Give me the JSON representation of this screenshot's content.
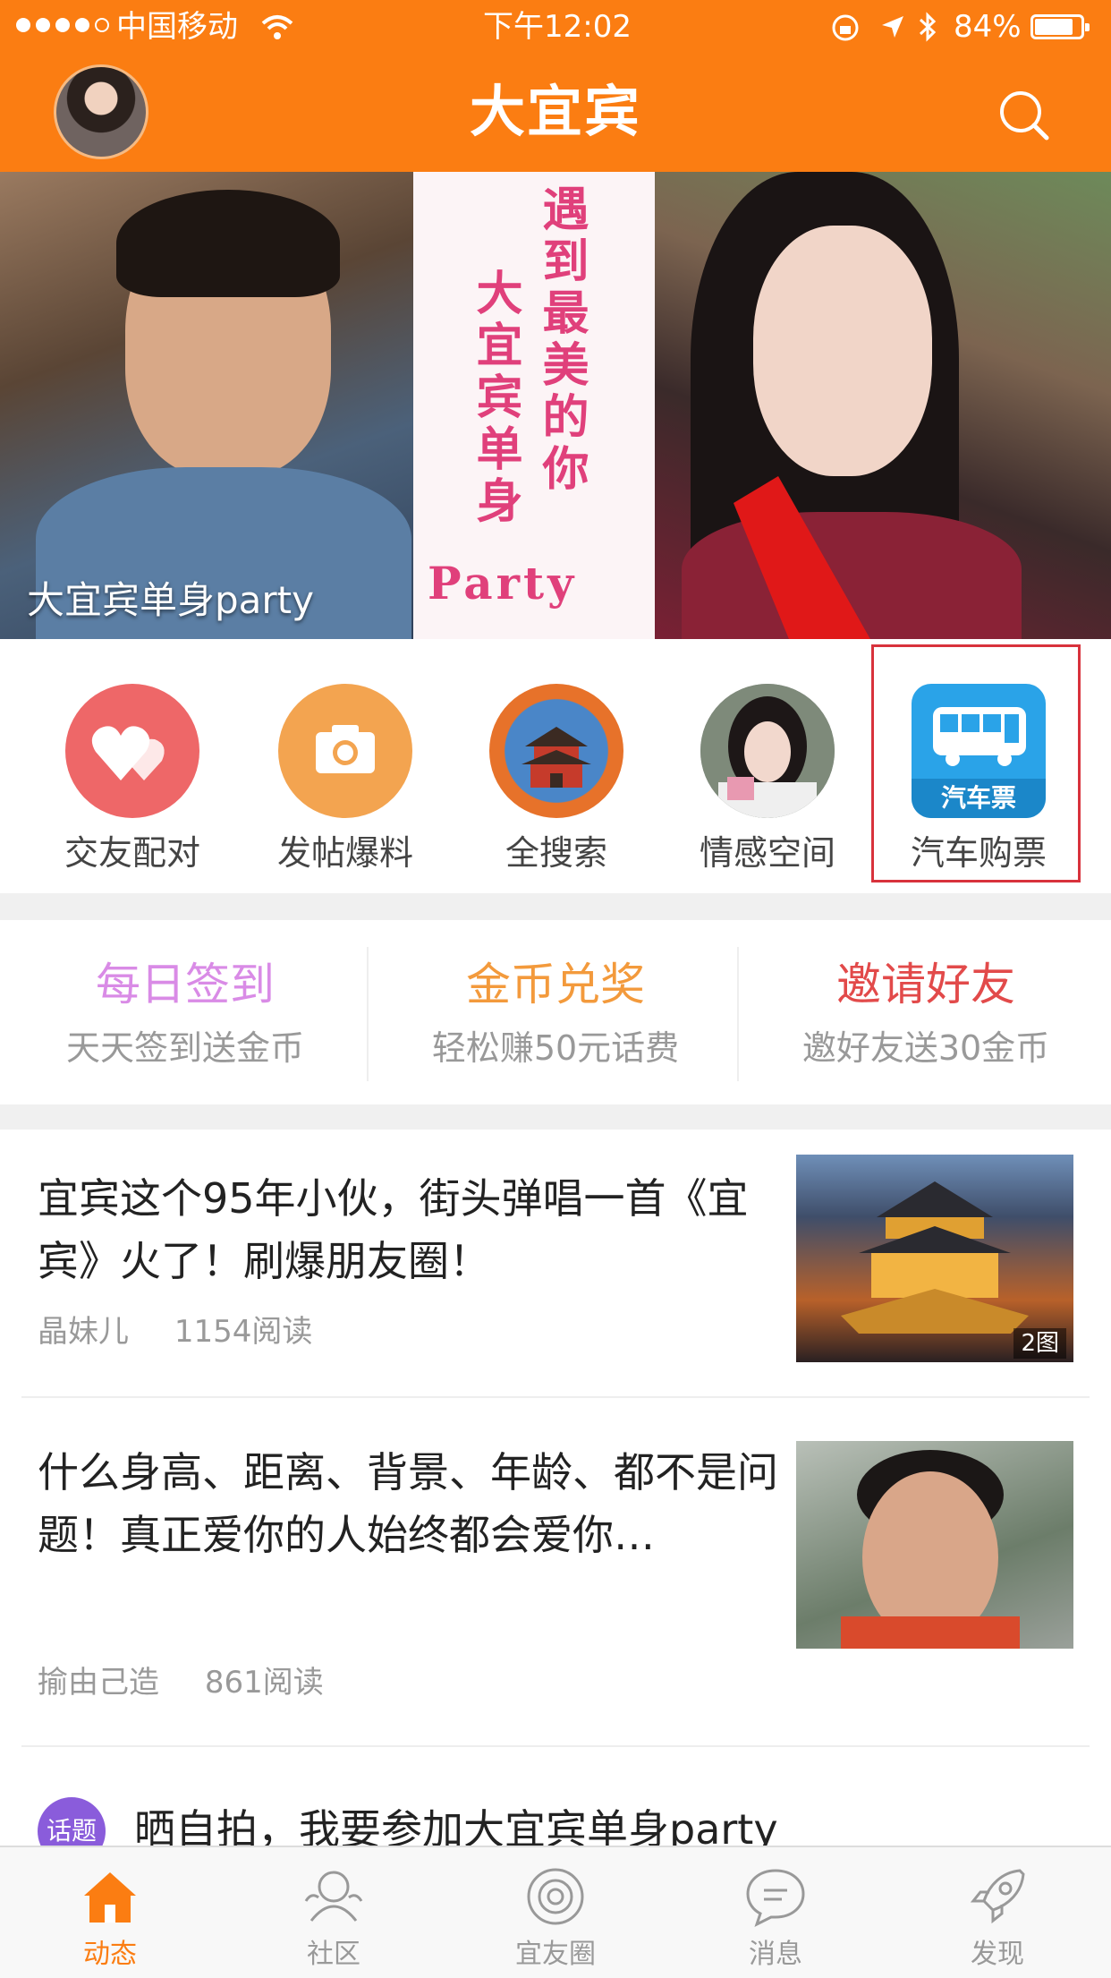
{
  "status_bar": {
    "carrier": "中国移动",
    "time": "下午12:02",
    "battery": "84%",
    "battery_level": 0.84
  },
  "header": {
    "title": "大宜宾"
  },
  "banner": {
    "caption": "大宜宾单身party",
    "line1": "遇到最美的你",
    "line2": "大宜宾单身",
    "line3": "Party"
  },
  "quick_actions": [
    {
      "label": "交友配对",
      "icon": "heart-icon"
    },
    {
      "label": "发帖爆料",
      "icon": "camera-icon"
    },
    {
      "label": "全搜索",
      "icon": "tower-icon"
    },
    {
      "label": "情感空间",
      "icon": "portrait-icon"
    },
    {
      "label": "汽车购票",
      "icon": "bus-icon",
      "badge": "汽车票"
    }
  ],
  "promos": [
    {
      "title": "每日签到",
      "subtitle": "天天签到送金币",
      "color": "#d98be6"
    },
    {
      "title": "金币兑奖",
      "subtitle": "轻松赚50元话费",
      "color": "#f39a3c"
    },
    {
      "title": "邀请好友",
      "subtitle": "邀好友送30金币",
      "color": "#e24a4a"
    }
  ],
  "feed": [
    {
      "title": "宜宾这个95年小伙，街头弹唱一首《宜宾》火了！刷爆朋友圈！",
      "author": "晶妹儿",
      "reads": "1154阅读",
      "image_count": "2图"
    },
    {
      "title": "什么身高、距离、背景、年龄、都不是问题！真正爱你的人始终都会爱你…",
      "author": "揄由己造",
      "reads": "861阅读"
    }
  ],
  "topic": {
    "tag": "话题",
    "title": "晒自拍，我要参加大宜宾单身party"
  },
  "tabbar": [
    {
      "label": "动态",
      "icon": "home-icon",
      "active": true
    },
    {
      "label": "社区",
      "icon": "community-icon",
      "active": false
    },
    {
      "label": "宜友圈",
      "icon": "circle-icon",
      "active": false
    },
    {
      "label": "消息",
      "icon": "message-icon",
      "active": false
    },
    {
      "label": "发现",
      "icon": "rocket-icon",
      "active": false
    }
  ],
  "colors": {
    "brand": "#fb7d12",
    "highlight": "#d8323c"
  }
}
